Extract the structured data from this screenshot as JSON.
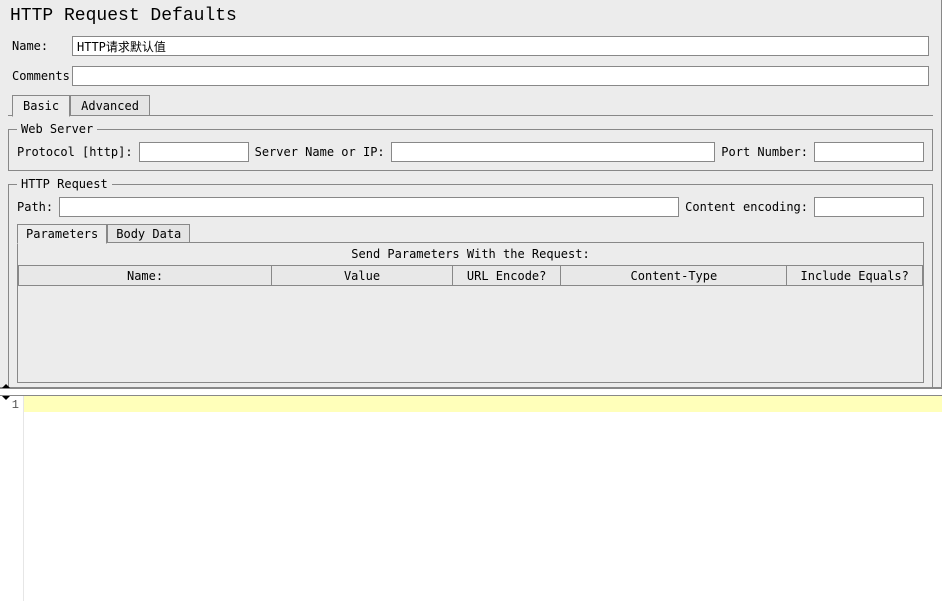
{
  "title": "HTTP Request Defaults",
  "nameLabel": "Name:",
  "nameValue": "HTTP请求默认值",
  "commentsLabel": "Comments:",
  "commentsValue": "",
  "tabs": {
    "basic": "Basic",
    "advanced": "Advanced"
  },
  "webServer": {
    "legend": "Web Server",
    "protocolLabel": "Protocol [http]:",
    "protocolValue": "",
    "serverLabel": "Server Name or IP:",
    "serverValue": "",
    "portLabel": "Port Number:",
    "portValue": ""
  },
  "httpRequest": {
    "legend": "HTTP Request",
    "pathLabel": "Path:",
    "pathValue": "",
    "encodingLabel": "Content encoding:",
    "encodingValue": ""
  },
  "innerTabs": {
    "parameters": "Parameters",
    "bodyData": "Body Data"
  },
  "paramSection": {
    "title": "Send Parameters With the Request:",
    "columns": {
      "name": "Name:",
      "value": "Value",
      "urlEncode": "URL Encode?",
      "contentType": "Content-Type",
      "includeEquals": "Include Equals?"
    }
  },
  "editor": {
    "lineNumber": "1"
  }
}
